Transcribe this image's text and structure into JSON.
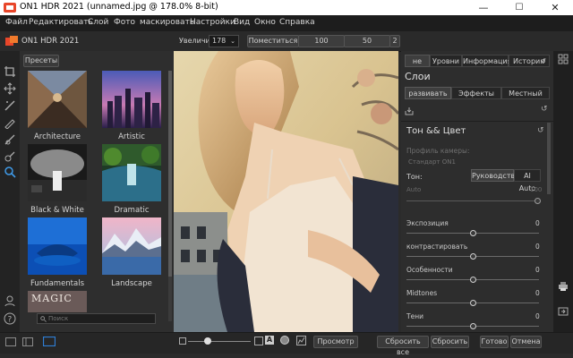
{
  "window": {
    "title": "ON1 HDR 2021 (unnamed.jpg @ 178.0% 8-bit)",
    "min_label": "—",
    "max_label": "☐",
    "close_label": "✕"
  },
  "menu": [
    "Файл",
    "Редактировать",
    "Слой",
    "Фото",
    "маскировать",
    "Настройки",
    "Вид",
    "Окно",
    "Справка"
  ],
  "toolbar": {
    "logo_text": "ON1 HDR 2021",
    "zoom_label": "Увеличить",
    "zoom_value": "178",
    "fit_label": "Поместиться",
    "z100": "100",
    "z50": "50",
    "z25": "2"
  },
  "presets": {
    "header_button": "Пресеты",
    "items": [
      {
        "label": "Architecture"
      },
      {
        "label": "Artistic"
      },
      {
        "label": "Black & White"
      },
      {
        "label": "Dramatic"
      },
      {
        "label": "Fundamentals"
      },
      {
        "label": "Landscape"
      },
      {
        "label": "MAGIC"
      }
    ],
    "search_placeholder": "Поиск"
  },
  "rpanel": {
    "top_tabs": [
      "не",
      "Уровни",
      "Информация",
      "История"
    ],
    "layers_title": "Слои",
    "sub_tabs": [
      "развивать",
      "Эффекты",
      "Местный"
    ],
    "section_title": "Тон && Цвет",
    "camera_profile_label": "Профиль камеры:",
    "camera_profile_value": "Стандарт ON1",
    "tone_label": "Тон:",
    "tone_manual": "Руководство",
    "tone_auto": "AI Auto",
    "auto_label": "Auto",
    "auto_value": "100",
    "sliders": [
      {
        "label": "Экспозиция",
        "value": "0",
        "level": 0.5
      },
      {
        "label": "контрастировать",
        "value": "0",
        "level": 0.5
      },
      {
        "label": "Особенности",
        "value": "0",
        "level": 0.5
      },
      {
        "label": "Midtones",
        "value": "0",
        "level": 0.5
      },
      {
        "label": "Тени",
        "value": "0",
        "level": 0.5
      }
    ]
  },
  "bottom": {
    "preview": "Просмотр",
    "reset_all": "Сбросить все",
    "reset": "Сбросить",
    "done": "Готово",
    "cancel": "Отмена",
    "text_a": "A"
  },
  "colors": {
    "accent_blue": "#2f7fd6",
    "active_tab": "#3e3e3e"
  }
}
